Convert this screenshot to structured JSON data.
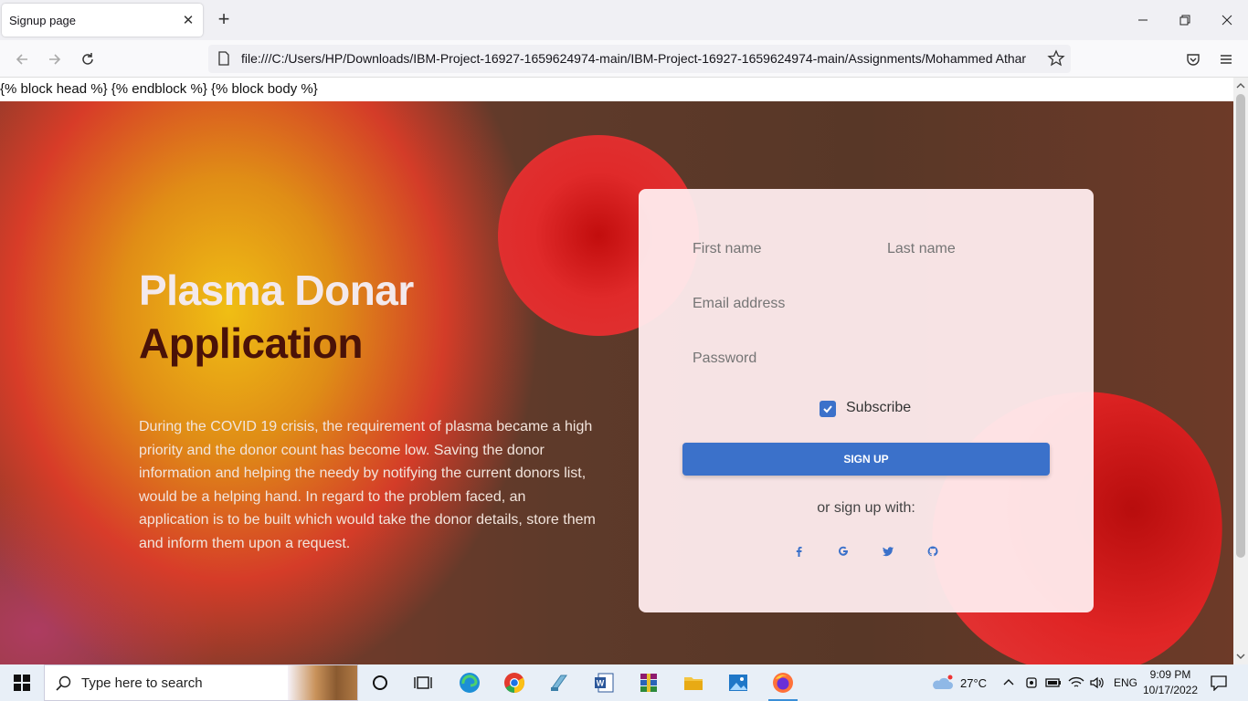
{
  "browser": {
    "tab_title": "Signup page",
    "new_tab": "+",
    "url": "file:///C:/Users/HP/Downloads/IBM-Project-16927-1659624974-main/IBM-Project-16927-1659624974-main/Assignments/Mohammed Athar",
    "window_controls": [
      "minimize-icon",
      "restore-icon",
      "close-icon"
    ]
  },
  "page": {
    "template_text": "{% block head %} {% endblock %} {% block body %}",
    "heading_line1": "Plasma Donar",
    "heading_line2": "Application",
    "description": "During the COVID 19 crisis, the requirement of plasma became a high priority and the donor count has become low. Saving the donor information and helping the needy by notifying the current donors list, would be a helping hand. In regard to the problem faced, an application is to be built which would take the donor details, store them and inform them upon a request.",
    "form": {
      "first_name_placeholder": "First name",
      "last_name_placeholder": "Last name",
      "email_placeholder": "Email address",
      "password_placeholder": "Password",
      "subscribe_label": "Subscribe",
      "subscribe_checked": true,
      "signup_label": "SIGN UP",
      "or_text": "or sign up with:",
      "social": [
        "facebook-icon",
        "google-icon",
        "twitter-icon",
        "github-icon"
      ]
    },
    "colors": {
      "accent": "#3b71ca",
      "heading_light": "#f3e9ec",
      "heading_dark": "#4a1208"
    }
  },
  "taskbar": {
    "search_placeholder": "Type here to search",
    "weather": "27°C",
    "language": "ENG",
    "time": "9:09 PM",
    "date": "10/17/2022"
  }
}
